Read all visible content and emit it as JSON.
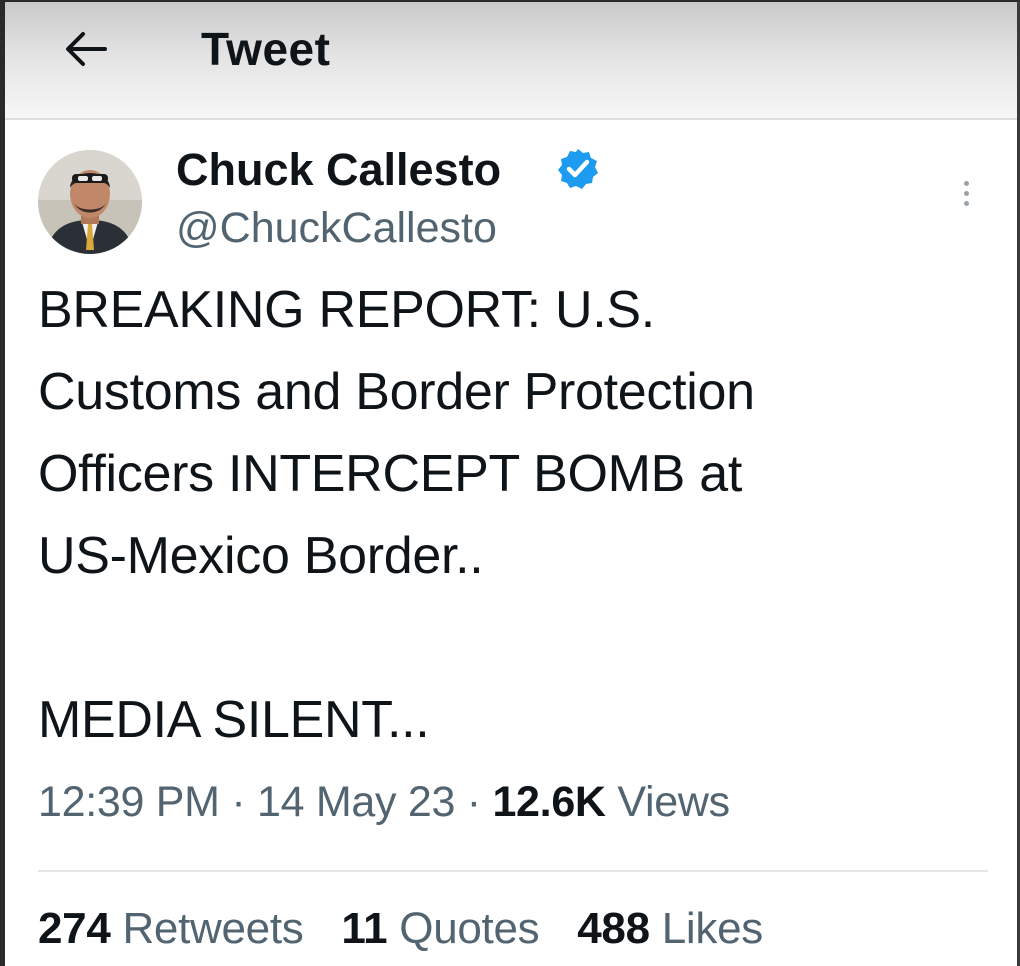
{
  "header": {
    "title": "Tweet",
    "back_icon": "arrow-left-icon"
  },
  "tweet": {
    "author": {
      "name": "Chuck Callesto",
      "handle": "@ChuckCallesto",
      "verified_icon": "verified-badge-icon",
      "verified_color": "#1d9bf0"
    },
    "more_icon": "more-vertical-icon",
    "text_lines": [
      "BREAKING REPORT: U.S.",
      "Customs and Border Protection",
      "Officers INTERCEPT BOMB at",
      "US-Mexico Border..",
      "",
      "MEDIA SILENT..."
    ],
    "time": "12:39 PM",
    "separator": "·",
    "date": "14 May 23",
    "views_count": "12.6K",
    "views_label": "Views"
  },
  "stats": [
    {
      "count": "274",
      "label": "Retweets"
    },
    {
      "count": "11",
      "label": "Quotes"
    },
    {
      "count": "488",
      "label": "Likes"
    }
  ],
  "colors": {
    "text_primary": "#0f1419",
    "text_secondary": "#536471",
    "accent": "#1d9bf0"
  }
}
